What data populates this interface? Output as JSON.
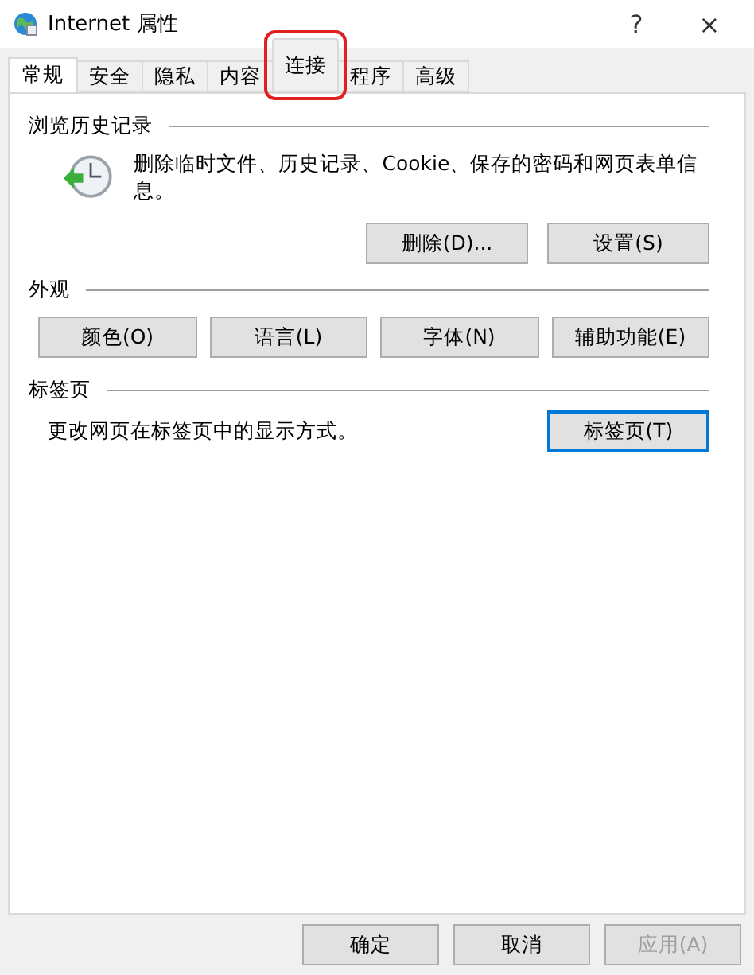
{
  "window": {
    "title": "Internet 属性",
    "help": "?",
    "close": "×"
  },
  "tabs": [
    {
      "label": "常规",
      "selected": true,
      "highlighted": false
    },
    {
      "label": "安全",
      "selected": false,
      "highlighted": false
    },
    {
      "label": "隐私",
      "selected": false,
      "highlighted": false
    },
    {
      "label": "内容",
      "selected": false,
      "highlighted": false
    },
    {
      "label": "连接",
      "selected": false,
      "highlighted": true
    },
    {
      "label": "程序",
      "selected": false,
      "highlighted": false
    },
    {
      "label": "高级",
      "selected": false,
      "highlighted": false
    }
  ],
  "history": {
    "heading": "浏览历史记录",
    "description": "删除临时文件、历史记录、Cookie、保存的密码和网页表单信息。",
    "buttons": [
      "删除(D)...",
      "设置(S)"
    ]
  },
  "appearance": {
    "heading": "外观",
    "buttons": [
      "颜色(O)",
      "语言(L)",
      "字体(N)",
      "辅助功能(E)"
    ]
  },
  "tab_section": {
    "heading": "标签页",
    "description": "更改网页在标签页中的显示方式。",
    "button": {
      "label": "标签页(T)",
      "focused": true
    }
  },
  "footer_buttons": [
    {
      "label": "确定",
      "disabled": false
    },
    {
      "label": "取消",
      "disabled": false
    },
    {
      "label": "应用(A)",
      "disabled": true
    }
  ]
}
